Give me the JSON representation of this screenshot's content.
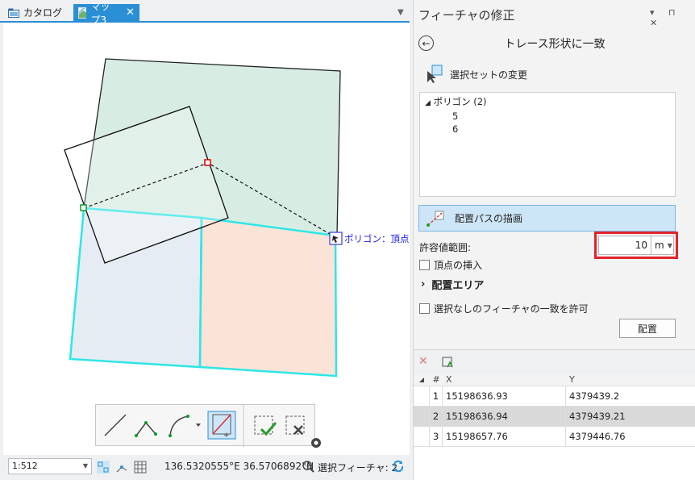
{
  "tabs": {
    "catalog": "カタログ",
    "map": "マップ3",
    "close": "✕"
  },
  "map": {
    "snap_label": "ポリゴン：頂点"
  },
  "status": {
    "scale": "1:512",
    "coords": "136.5320555°E 36.5706892°N",
    "selected": "選択フィーチャ: 2"
  },
  "pane": {
    "title": "フィーチャの修正",
    "tool_name": "トレース形状に一致",
    "selection_change": "選択セットの変更",
    "tree": {
      "group": "ポリゴン (2)",
      "items": [
        "5",
        "6"
      ]
    },
    "draw_path": "配置パスの描画",
    "tolerance_label": "許容値範囲:",
    "tolerance_value": "10",
    "tolerance_unit": "m",
    "insert_vertices": "頂点の挿入",
    "placement_area": "配置エリア",
    "allow_unselected": "選択なしのフィーチャの一致を許可",
    "apply": "配置"
  },
  "vertex_table": {
    "headers": {
      "num": "#",
      "x": "X",
      "y": "Y"
    },
    "rows": [
      {
        "n": "1",
        "x": "15198636.93",
        "y": "4379439.2"
      },
      {
        "n": "2",
        "x": "15198636.94",
        "y": "4379439.21"
      },
      {
        "n": "3",
        "x": "15198657.76",
        "y": "4379446.76"
      }
    ]
  }
}
